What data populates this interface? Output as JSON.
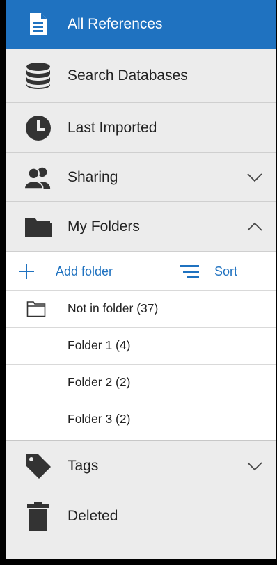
{
  "nav": {
    "all_references": "All References",
    "search_databases": "Search Databases",
    "last_imported": "Last Imported",
    "sharing": "Sharing",
    "my_folders": "My Folders",
    "tags": "Tags",
    "deleted": "Deleted"
  },
  "folders": {
    "add_folder": "Add folder",
    "sort": "Sort",
    "items": [
      {
        "label": "Not in folder (37)"
      },
      {
        "label": "Folder 1 (4)"
      },
      {
        "label": "Folder 2 (2)"
      },
      {
        "label": "Folder 3 (2)"
      }
    ]
  },
  "icons": {
    "all_references": "document-icon",
    "search_databases": "database-icon",
    "last_imported": "clock-icon",
    "sharing": "people-icon",
    "my_folders": "folder-icon",
    "tags": "tag-icon",
    "deleted": "trash-icon",
    "add_folder": "plus-icon",
    "sort": "sort-icon",
    "not_in_folder": "folder-outline-icon"
  },
  "colors": {
    "accent": "#1f72c0",
    "nav_bg": "#ececec",
    "icon": "#333333"
  }
}
